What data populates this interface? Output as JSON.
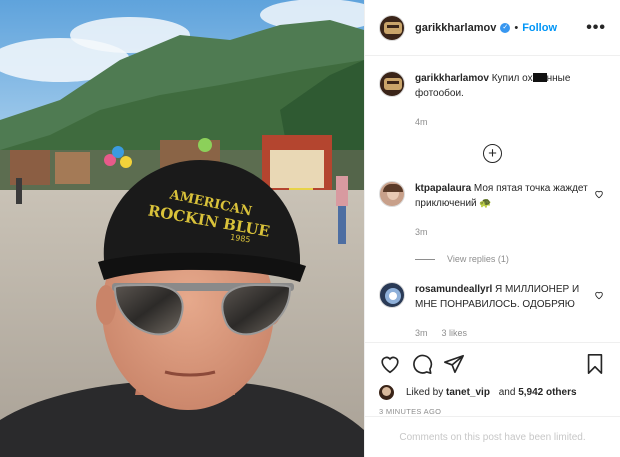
{
  "post": {
    "author": "garikkharlamov",
    "verified_mark": "✓",
    "separator": "•",
    "follow_label": "Follow",
    "more_label": "•••",
    "caption_author": "garikkharlamov",
    "caption_before": "Купил ох",
    "caption_after": "нные фотообои.",
    "caption_age": "4m"
  },
  "load_more": {
    "label": "+"
  },
  "comments": [
    {
      "author": "ktpapalaura",
      "text": "Моя пятая точка жаждет приключений",
      "emoji": "🐢",
      "age": "3m",
      "likes": ""
    },
    {
      "author": "rosamundeallyrl",
      "text": "Я МИЛЛИОНЕР И МНЕ ПОНРАВИЛОСЬ. ОДОБРЯЮ",
      "age": "3m",
      "likes": "3 likes"
    }
  ],
  "view_replies_label": "View replies (1)",
  "liked_by": {
    "prefix": "Liked by",
    "user": "tanet_vip",
    "middle": "and",
    "count": "5,942 others"
  },
  "timestamp": "3 MINUTES AGO",
  "comments_limited": "Comments on this post have been limited.",
  "photo": {
    "cap_text_line1": "AMERICAN",
    "cap_text_line2": "ROCKIN BLUE",
    "cap_text_line3": "1985"
  },
  "colors": {
    "accent": "#0095f6",
    "sky": "#9ec9ea",
    "cap": "#1a1a1a",
    "cap_text": "#d9c23a"
  }
}
